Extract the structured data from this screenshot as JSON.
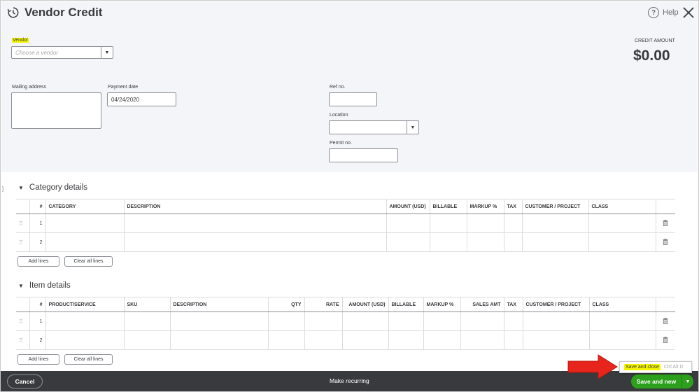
{
  "header": {
    "title": "Vendor Credit",
    "help_label": "Help",
    "help_icon": "?"
  },
  "form": {
    "vendor_label": "Vendor",
    "vendor_placeholder": "Choose a vendor",
    "mailing_address_label": "Mailing address",
    "payment_date_label": "Payment date",
    "payment_date_value": "04/24/2020",
    "ref_no_label": "Ref no.",
    "location_label": "Location",
    "permit_no_label": "Permit no.",
    "credit_amount_label": "CREDIT AMOUNT",
    "credit_amount_value": "$0.00"
  },
  "category_details": {
    "title": "Category details",
    "columns": [
      "#",
      "CATEGORY",
      "DESCRIPTION",
      "AMOUNT (USD)",
      "BILLABLE",
      "MARKUP %",
      "TAX",
      "CUSTOMER / PROJECT",
      "CLASS"
    ],
    "rows": [
      {
        "num": "1"
      },
      {
        "num": "2"
      }
    ],
    "add_lines_label": "Add lines",
    "clear_all_label": "Clear all lines"
  },
  "item_details": {
    "title": "Item details",
    "columns": [
      "#",
      "PRODUCT/SERVICE",
      "SKU",
      "DESCRIPTION",
      "QTY",
      "RATE",
      "AMOUNT (USD)",
      "BILLABLE",
      "MARKUP %",
      "SALES AMT",
      "TAX",
      "CUSTOMER / PROJECT",
      "CLASS"
    ],
    "rows": [
      {
        "num": "1"
      },
      {
        "num": "2"
      }
    ],
    "add_lines_label": "Add lines",
    "clear_all_label": "Clear all lines"
  },
  "footer": {
    "cancel_label": "Cancel",
    "make_recurring_label": "Make recurring",
    "save_new_label": "Save and new"
  },
  "popup": {
    "save_close_label": "Save and close",
    "shortcut": "Ctrl Alt D"
  },
  "colors": {
    "footer_bg": "#393a3d",
    "primary_green": "#2ca01c",
    "highlight": "#f5f500",
    "arrow_red": "#e8251c"
  }
}
